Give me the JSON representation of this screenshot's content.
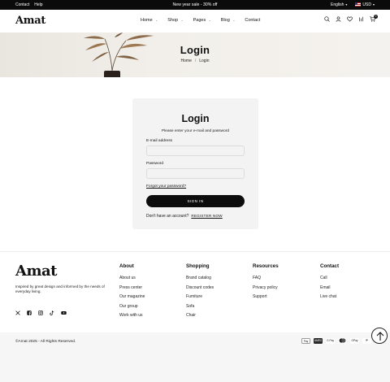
{
  "topbar": {
    "links": [
      "Contact",
      "Help"
    ],
    "promo": "New year sale - 30% off",
    "language": "English",
    "currency": "USD"
  },
  "header": {
    "logo": "Amat",
    "nav": [
      {
        "label": "Home",
        "has_dropdown": true
      },
      {
        "label": "Shop",
        "has_dropdown": true
      },
      {
        "label": "Pages",
        "has_dropdown": true
      },
      {
        "label": "Blog",
        "has_dropdown": true
      },
      {
        "label": "Contact",
        "has_dropdown": false
      }
    ],
    "icons": [
      "search-icon",
      "user-icon",
      "heart-icon",
      "compare-icon",
      "cart-icon"
    ],
    "cart_count": "0"
  },
  "banner": {
    "title": "Login",
    "breadcrumb": [
      "Home",
      "Login"
    ]
  },
  "login": {
    "title": "Login",
    "subtitle": "Please enter your e-mail and password",
    "email_label": "E-mail address",
    "email_value": "",
    "password_label": "Password",
    "password_value": "",
    "forgot": "Forgot your password?",
    "submit": "SIGN IN",
    "no_account": "Don't have an account?",
    "register": "REGISTER NOW"
  },
  "footer": {
    "logo": "Amat",
    "tagline": "Inspired by great design and informed by the needs of everyday living.",
    "social": [
      "x-icon",
      "facebook-icon",
      "instagram-icon",
      "tiktok-icon",
      "youtube-icon"
    ],
    "columns": [
      {
        "title": "About",
        "items": [
          "About us",
          "Press center",
          "Our magazine",
          "Our group",
          "Work with us"
        ]
      },
      {
        "title": "Shopping",
        "items": [
          "Brand catalog",
          "Discount codes",
          "Furniture",
          "Sofa",
          "Chair"
        ]
      },
      {
        "title": "Resources",
        "items": [
          "FAQ",
          "Privacy policy",
          "Support"
        ]
      },
      {
        "title": "Contact",
        "items": [
          "Call",
          "Email",
          "Live chat"
        ]
      }
    ],
    "copyright": "©Amat 2025 - All Rights Reserved.",
    "payments": [
      "Apple Pay",
      "Amex",
      "G Pay",
      "Mastercard",
      "GPay",
      "PayPal",
      "Visa"
    ]
  },
  "colors": {
    "topbar_bg": "#0b0b0b",
    "button_bg": "#0c0c0c",
    "card_bg": "#f3f3f3",
    "banner_bg": "#efece7"
  }
}
